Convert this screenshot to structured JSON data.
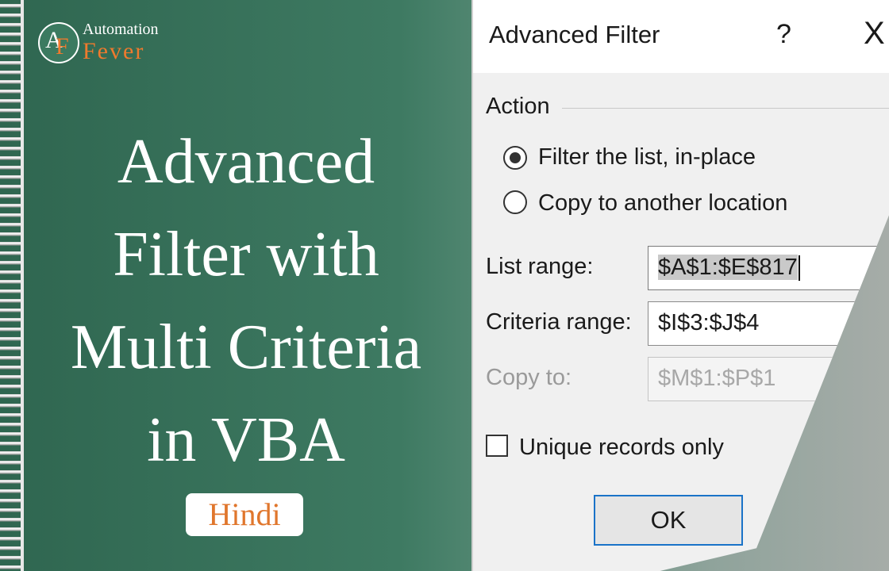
{
  "logo": {
    "mark_a": "A",
    "mark_f": "F",
    "line1": "Automation",
    "line2": "Fever"
  },
  "title": {
    "lines": [
      "Advanced",
      "Filter with",
      "Multi Criteria",
      "in VBA"
    ]
  },
  "badge": "Hindi",
  "dialog": {
    "title": "Advanced Filter",
    "help": "?",
    "close": "X",
    "action_group": "Action",
    "options": [
      {
        "label": "Filter the list, in-place",
        "selected": true
      },
      {
        "label": "Copy to another location",
        "selected": false
      }
    ],
    "fields": {
      "list_range": {
        "label": "List range:",
        "value": "$A$1:$E$817"
      },
      "criteria_range": {
        "label": "Criteria range:",
        "value": "$I$3:$J$4"
      },
      "copy_to": {
        "label": "Copy to:",
        "value": "$M$1:$P$1"
      }
    },
    "unique_label": "Unique records only",
    "unique_checked": false,
    "ok_label": "OK"
  },
  "colors": {
    "accent_green": "#2f6650",
    "brand_orange": "#e0762c",
    "focus_blue": "#1a73c8"
  }
}
